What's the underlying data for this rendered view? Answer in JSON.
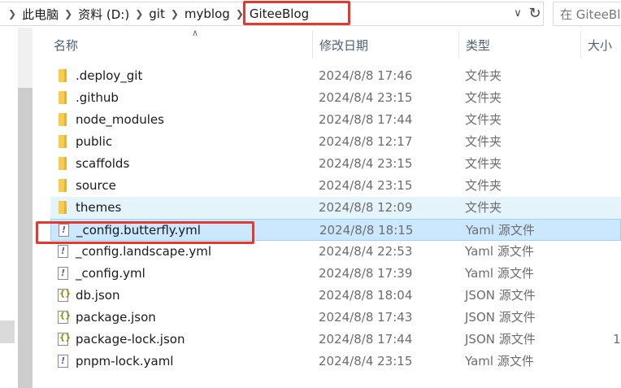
{
  "address_bar": {
    "crumbs": [
      "此电脑",
      "资料 (D:)",
      "git",
      "myblog",
      "GiteeBlog"
    ],
    "dropdown_icon": "chevron-down-icon",
    "refresh_icon": "refresh-icon"
  },
  "search": {
    "placeholder": "在 GiteeBlog"
  },
  "columns": {
    "name": "名称",
    "date": "修改日期",
    "type": "类型",
    "size": "大小"
  },
  "files": [
    {
      "name": ".deploy_git",
      "date": "2024/8/8 17:46",
      "type": "文件夹",
      "size": "",
      "icon": "folder-icon"
    },
    {
      "name": ".github",
      "date": "2024/8/4 23:15",
      "type": "文件夹",
      "size": "",
      "icon": "folder-icon"
    },
    {
      "name": "node_modules",
      "date": "2024/8/8 17:44",
      "type": "文件夹",
      "size": "",
      "icon": "folder-icon"
    },
    {
      "name": "public",
      "date": "2024/8/8 12:17",
      "type": "文件夹",
      "size": "",
      "icon": "folder-icon"
    },
    {
      "name": "scaffolds",
      "date": "2024/8/4 23:15",
      "type": "文件夹",
      "size": "",
      "icon": "folder-icon"
    },
    {
      "name": "source",
      "date": "2024/8/4 23:15",
      "type": "文件夹",
      "size": "",
      "icon": "folder-icon"
    },
    {
      "name": "themes",
      "date": "2024/8/8 12:09",
      "type": "文件夹",
      "size": "",
      "icon": "folder-icon"
    },
    {
      "name": "_config.butterfly.yml",
      "date": "2024/8/8 18:15",
      "type": "Yaml 源文件",
      "size": "",
      "icon": "yaml-file-icon"
    },
    {
      "name": "_config.landscape.yml",
      "date": "2024/8/4 22:53",
      "type": "Yaml 源文件",
      "size": "",
      "icon": "yaml-file-icon"
    },
    {
      "name": "_config.yml",
      "date": "2024/8/8 17:39",
      "type": "Yaml 源文件",
      "size": "",
      "icon": "yaml-file-icon"
    },
    {
      "name": "db.json",
      "date": "2024/8/8 18:04",
      "type": "JSON 源文件",
      "size": "",
      "icon": "json-file-icon"
    },
    {
      "name": "package.json",
      "date": "2024/8/8 17:43",
      "type": "JSON 源文件",
      "size": "",
      "icon": "json-file-icon"
    },
    {
      "name": "package-lock.json",
      "date": "2024/8/8 17:44",
      "type": "JSON 源文件",
      "size": "1",
      "icon": "json-file-icon"
    },
    {
      "name": "pnpm-lock.yaml",
      "date": "2024/8/4 23:15",
      "type": "Yaml 源文件",
      "size": "",
      "icon": "yaml-file-icon"
    }
  ],
  "colors": {
    "highlight": "#e33a2f",
    "selected_row": "#cce8ff",
    "hover_row": "#e5f3fb",
    "folder": "#f7cb4d"
  }
}
